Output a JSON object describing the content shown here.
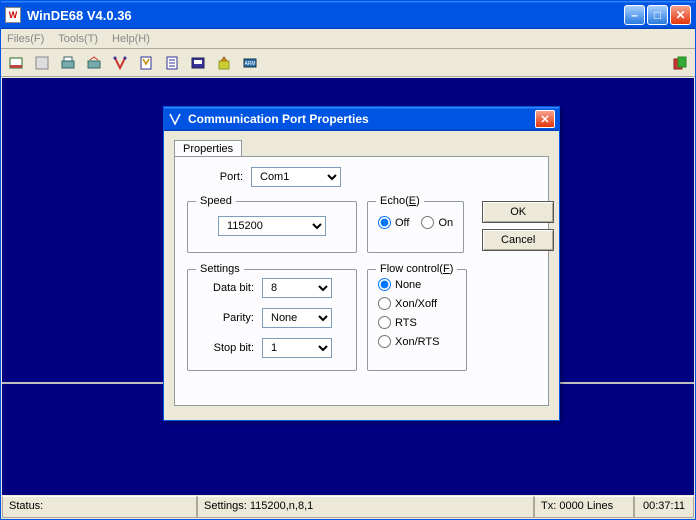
{
  "app": {
    "title": "WinDE68 V4.0.36",
    "icon_text": "W"
  },
  "menu": {
    "files": "Files(F)",
    "tools": "Tools(T)",
    "help": "Help(H)"
  },
  "status": {
    "label": "Status:",
    "settings": "Settings: 115200,n,8,1",
    "tx": "Tx: 0000 Lines",
    "time": "00:37:11"
  },
  "dialog": {
    "title": "Communication Port Properties",
    "tab_label": "Properties",
    "port_label": "Port:",
    "port_value": "Com1",
    "speed": {
      "legend": "Speed",
      "value": "115200"
    },
    "echo": {
      "legend_prefix": "Echo(",
      "legend_key": "E",
      "legend_suffix": ")",
      "off": "Off",
      "on": "On",
      "selected": "off"
    },
    "buttons": {
      "ok": "OK",
      "cancel": "Cancel"
    },
    "settings": {
      "legend": "Settings",
      "databit_label": "Data bit:",
      "databit_value": "8",
      "parity_label": "Parity:",
      "parity_value": "None",
      "stopbit_label": "Stop bit:",
      "stopbit_value": "1"
    },
    "flow": {
      "legend_prefix": "Flow control(",
      "legend_key": "F",
      "legend_suffix": ")",
      "options": {
        "none": "None",
        "xonxoff": "Xon/Xoff",
        "rts": "RTS",
        "xonrts": "Xon/RTS"
      },
      "selected": "none"
    }
  }
}
